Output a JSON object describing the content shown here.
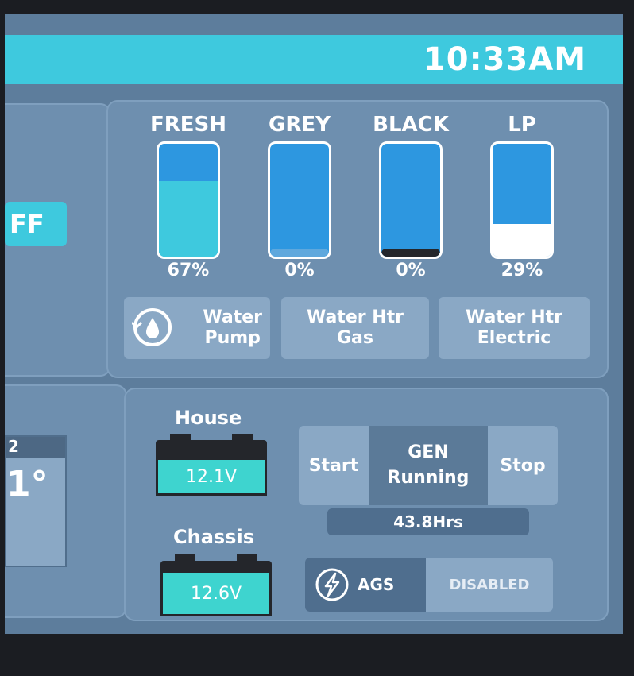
{
  "header": {
    "time": "10:33AM"
  },
  "left": {
    "off_label": "FF",
    "thermo_head": "2",
    "thermo_value": "1°"
  },
  "tanks": [
    {
      "label": "FRESH",
      "percent_text": "67%",
      "level": 0.67,
      "fill_color": "#3ec9de"
    },
    {
      "label": "GREY",
      "percent_text": "0%",
      "level": 0.0,
      "fill_color": "#5fa8dd"
    },
    {
      "label": "BLACK",
      "percent_text": "0%",
      "level": 0.0,
      "fill_color": "#24262b"
    },
    {
      "label": "LP",
      "percent_text": "29%",
      "level": 0.29,
      "fill_color": "#ffffff"
    }
  ],
  "controls": {
    "water_pump": {
      "line1": "Water",
      "line2": "Pump",
      "icon": "water-pump-icon"
    },
    "water_htr_gas": {
      "line1": "Water Htr",
      "line2": "Gas"
    },
    "water_htr_electric": {
      "line1": "Water Htr",
      "line2": "Electric"
    }
  },
  "power": {
    "house_label": "House",
    "house_voltage": "12.1V",
    "chassis_label": "Chassis",
    "chassis_voltage": "12.6V",
    "generator": {
      "start_label": "Start",
      "status_line1": "GEN",
      "status_line2": "Running",
      "stop_label": "Stop",
      "hours": "43.8Hrs"
    },
    "ags": {
      "label": "AGS",
      "status": "DISABLED",
      "icon": "lightning-icon"
    }
  },
  "colors": {
    "accent": "#3ec9de",
    "panel": "#6e8faf",
    "battery": "#3ed4cf"
  }
}
